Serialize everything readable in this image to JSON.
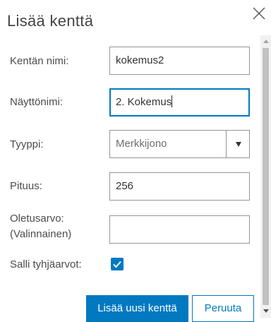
{
  "dialog": {
    "title": "Lisää kenttä",
    "close_icon": "close-icon"
  },
  "form": {
    "field_name": {
      "label": "Kentän nimi:",
      "value": "kokemus2"
    },
    "display_name": {
      "label": "Näyttönimi:",
      "value": "2. Kokemus"
    },
    "type": {
      "label": "Tyyppi:",
      "selected": "Merkkijono",
      "icon": "chevron-down-icon"
    },
    "length": {
      "label": "Pituus:",
      "value": "256"
    },
    "default_value": {
      "label_line1": "Oletusarvo:",
      "label_line2": "(Valinnainen)",
      "value": ""
    },
    "allow_null": {
      "label": "Salli tyhjäarvot:",
      "checked": true
    }
  },
  "buttons": {
    "add": "Lisää uusi kenttä",
    "cancel": "Peruuta"
  },
  "colors": {
    "accent": "#0079c1",
    "text": "#4c4c4c",
    "border": "#959595"
  }
}
